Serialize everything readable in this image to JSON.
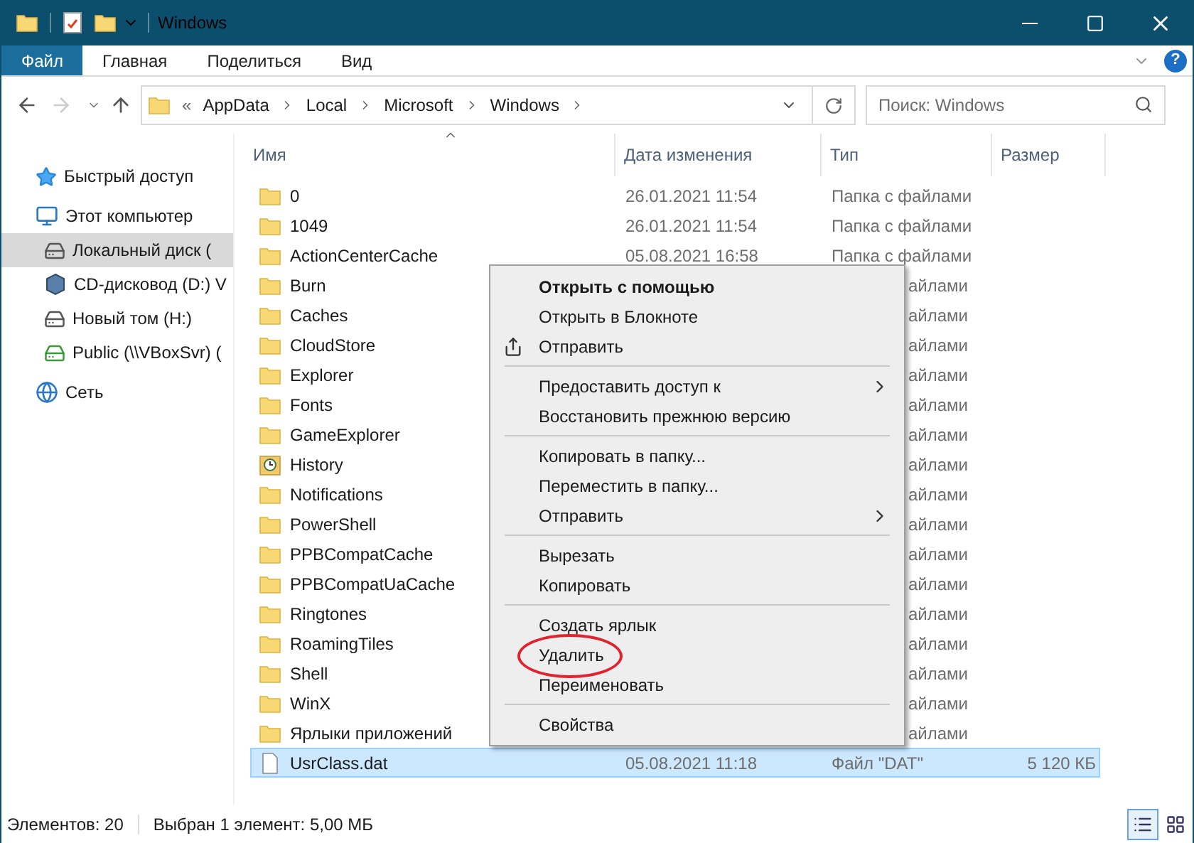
{
  "window": {
    "title": "Windows"
  },
  "ribbon": {
    "tabs": [
      {
        "label": "Файл",
        "selected": true
      },
      {
        "label": "Главная",
        "selected": false
      },
      {
        "label": "Поделиться",
        "selected": false
      },
      {
        "label": "Вид",
        "selected": false
      }
    ],
    "help": "?"
  },
  "nav": {
    "back_disabled": false,
    "forward_disabled": true
  },
  "address": {
    "overflow": "«",
    "path": [
      "AppData",
      "Local",
      "Microsoft",
      "Windows"
    ]
  },
  "search": {
    "placeholder": "Поиск: Windows"
  },
  "sidebar": {
    "items": [
      {
        "label": "Быстрый доступ",
        "kind": "star",
        "selected": false
      },
      {
        "label": "Этот компьютер",
        "kind": "computer",
        "selected": false,
        "children": [
          {
            "label": "Локальный диск (",
            "kind": "system-drive",
            "selected": true
          },
          {
            "label": "CD-дисковод (D:) V",
            "kind": "cd",
            "selected": false
          },
          {
            "label": "Новый том (H:)",
            "kind": "drive",
            "selected": false
          },
          {
            "label": "Public (\\\\VBoxSvr) (",
            "kind": "network-drive",
            "selected": false
          }
        ]
      },
      {
        "label": "Сеть",
        "kind": "network",
        "selected": false
      }
    ]
  },
  "table": {
    "columns": [
      "Имя",
      "Дата изменения",
      "Тип",
      "Размер"
    ],
    "rows": [
      {
        "kind": "folder",
        "name": "0",
        "date": "26.01.2021 11:54",
        "type": "Папка с файлами",
        "selected": false
      },
      {
        "kind": "folder",
        "name": "1049",
        "date": "26.01.2021 11:54",
        "type": "Папка с файлами",
        "selected": false
      },
      {
        "kind": "folder",
        "name": "ActionCenterCache",
        "date": "05.08.2021 16:58",
        "type": "Папка с файлами",
        "selected": false
      },
      {
        "kind": "folder",
        "name": "Burn",
        "type": "айлами",
        "type_cut": true,
        "selected": false
      },
      {
        "kind": "folder",
        "name": "Caches",
        "type": "айлами",
        "type_cut": true,
        "selected": false
      },
      {
        "kind": "folder",
        "name": "CloudStore",
        "type": "айлами",
        "type_cut": true,
        "selected": false
      },
      {
        "kind": "folder",
        "name": "Explorer",
        "type": "айлами",
        "type_cut": true,
        "selected": false
      },
      {
        "kind": "folder",
        "name": "Fonts",
        "type": "айлами",
        "type_cut": true,
        "selected": false
      },
      {
        "kind": "folder",
        "name": "GameExplorer",
        "type": "айлами",
        "type_cut": true,
        "selected": false
      },
      {
        "kind": "history",
        "name": "History",
        "type": "айлами",
        "type_cut": true,
        "selected": false
      },
      {
        "kind": "folder",
        "name": "Notifications",
        "type": "айлами",
        "type_cut": true,
        "selected": false
      },
      {
        "kind": "folder",
        "name": "PowerShell",
        "type": "айлами",
        "type_cut": true,
        "selected": false
      },
      {
        "kind": "folder",
        "name": "PPBCompatCache",
        "type": "айлами",
        "type_cut": true,
        "selected": false
      },
      {
        "kind": "folder",
        "name": "PPBCompatUaCache",
        "type": "айлами",
        "type_cut": true,
        "selected": false
      },
      {
        "kind": "folder",
        "name": "Ringtones",
        "type": "айлами",
        "type_cut": true,
        "selected": false
      },
      {
        "kind": "folder",
        "name": "RoamingTiles",
        "type": "айлами",
        "type_cut": true,
        "selected": false
      },
      {
        "kind": "folder",
        "name": "Shell",
        "type": "айлами",
        "type_cut": true,
        "selected": false
      },
      {
        "kind": "folder",
        "name": "WinX",
        "type": "айлами",
        "type_cut": true,
        "selected": false
      },
      {
        "kind": "folder",
        "name": "Ярлыки приложений",
        "type": "айлами",
        "type_cut": true,
        "selected": false
      },
      {
        "kind": "file",
        "name": "UsrClass.dat",
        "date": "05.08.2021 11:18",
        "type": "Файл \"DAT\"",
        "size": "5 120 КБ",
        "selected": true
      }
    ]
  },
  "context_menu": {
    "items": [
      {
        "kind": "item",
        "label": "Открыть с помощью",
        "bold": true
      },
      {
        "kind": "item",
        "label": "Открыть в Блокноте"
      },
      {
        "kind": "share-item",
        "label": "Отправить"
      },
      {
        "kind": "separator"
      },
      {
        "kind": "item",
        "label": "Предоставить доступ к",
        "submenu": true
      },
      {
        "kind": "item",
        "label": "Восстановить прежнюю версию"
      },
      {
        "kind": "separator"
      },
      {
        "kind": "item",
        "label": "Копировать в папку..."
      },
      {
        "kind": "item",
        "label": "Переместить в папку..."
      },
      {
        "kind": "item",
        "label": "Отправить",
        "submenu": true
      },
      {
        "kind": "separator"
      },
      {
        "kind": "item",
        "label": "Вырезать"
      },
      {
        "kind": "item",
        "label": "Копировать"
      },
      {
        "kind": "separator"
      },
      {
        "kind": "item",
        "label": "Создать ярлык"
      },
      {
        "kind": "item",
        "label": "Удалить",
        "circled": true
      },
      {
        "kind": "item",
        "label": "Переименовать"
      },
      {
        "kind": "separator"
      },
      {
        "kind": "item",
        "label": "Свойства"
      }
    ]
  },
  "status_bar": {
    "count": "Элементов: 20",
    "selection": "Выбран 1 элемент: 5,00 МБ",
    "views": [
      {
        "kind": "details",
        "selected": true
      },
      {
        "kind": "tiles",
        "selected": false
      }
    ]
  }
}
